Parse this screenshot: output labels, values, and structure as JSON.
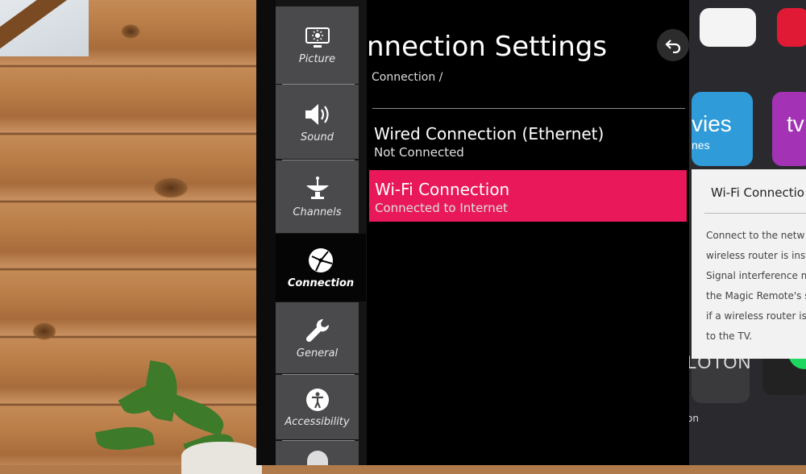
{
  "screen": {
    "title": "nnection Settings",
    "breadcrumb": "Connection /"
  },
  "sidebar": {
    "items": [
      {
        "label": "Picture",
        "icon": "picture-icon"
      },
      {
        "label": "Sound",
        "icon": "sound-icon"
      },
      {
        "label": "Channels",
        "icon": "channels-icon"
      },
      {
        "label": "Connection",
        "icon": "connection-icon",
        "active": true
      },
      {
        "label": "General",
        "icon": "wrench-icon"
      },
      {
        "label": "Accessibility",
        "icon": "accessibility-icon"
      }
    ]
  },
  "connections": [
    {
      "title": "Wired Connection (Ethernet)",
      "status": "Not Connected",
      "selected": false
    },
    {
      "title": "Wi-Fi Connection",
      "status": "Connected to Internet",
      "selected": true
    }
  ],
  "popup": {
    "title": "Wi-Fi Connectio",
    "lines": [
      "Connect to the netw",
      "wireless router is inst",
      "Signal interference ma",
      "the Magic Remote's se",
      "if a wireless router is t",
      "to the TV."
    ]
  },
  "home_tiles": {
    "movies_text": "vies",
    "movies_sub": "nes",
    "tv_text": "tv",
    "peloton_text": "LOTON",
    "peloton_sub": "oton"
  },
  "colors": {
    "accent": "#e8185a",
    "sidebar": "#4a4a4c",
    "panel": "#000000"
  }
}
